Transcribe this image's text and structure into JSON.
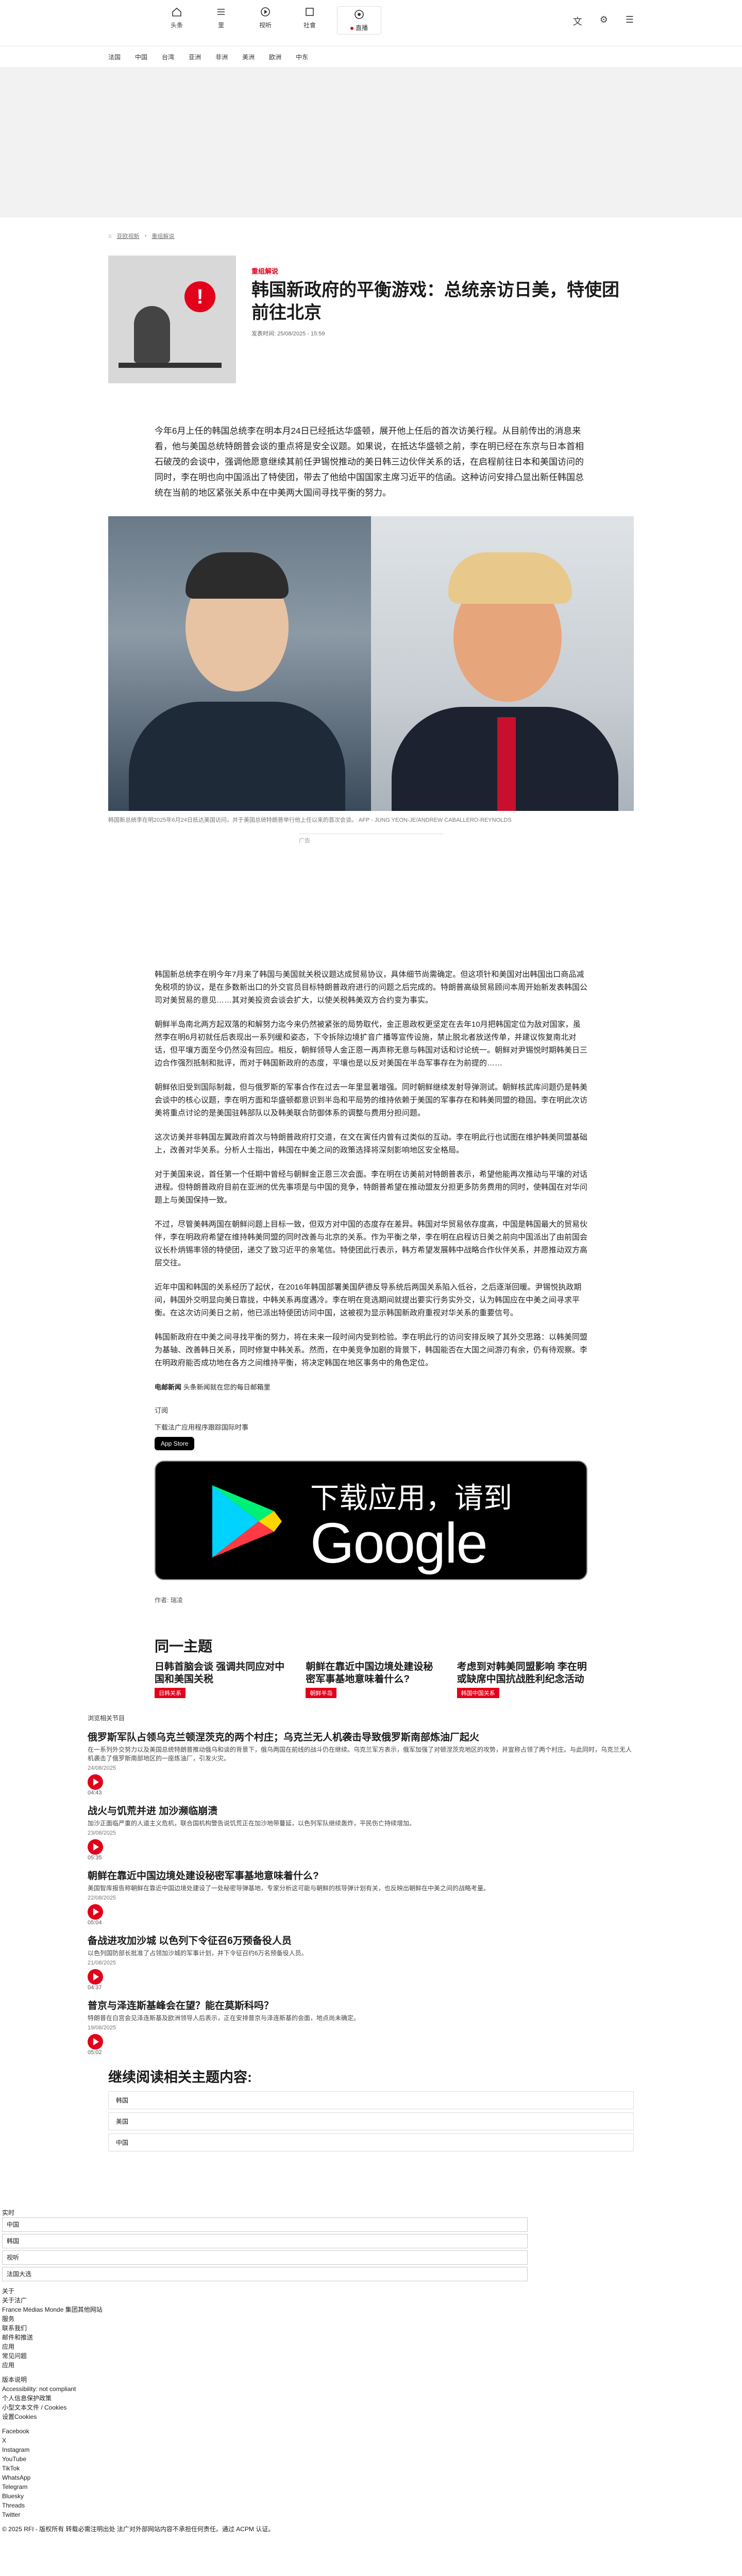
{
  "nav": {
    "items": [
      {
        "label": "头条"
      },
      {
        "label": "里"
      },
      {
        "label": "视听"
      },
      {
        "label": "社會"
      },
      {
        "label": "直播"
      }
    ],
    "live_label": "●跳上 有台"
  },
  "subnav": [
    "法国",
    "中国",
    "台湾",
    "亚洲",
    "非洲",
    "美洲",
    "欧洲",
    "中东"
  ],
  "breadcrumb": [
    "⌂",
    "亚欧视新",
    "重组解说"
  ],
  "article": {
    "kicker": "重组解说",
    "title": "韩国新政府的平衡游戏：总统亲访日美，特使团前往北京",
    "published_label": "发表时间:",
    "published": "25/08/2025 - 15:59",
    "lead": "今年6月上任的韩国总统李在明本月24日已经抵达华盛顿，展开他上任后的首次访美行程。从目前传出的消息来看，他与美国总统特朗普会谈的重点将是安全议题。如果说，在抵达华盛顿之前，李在明已经在东京与日本首相石破茂的会谈中，强调他愿意继续其前任尹锡悦推动的美日韩三边伙伴关系的话，在启程前往日本和美国访问的同时，李在明也向中国派出了特使团，带去了他给中国国家主席习近平的信函。这种访问安排凸显出新任韩国总统在当前的地区紧张关系中在中美两大国间寻找平衡的努力。",
    "photo_caption": "韩国新总统李在明2025年6月24日抵达美国访问，并于美国总统特朗普举行他上任以来的首次会谈。 AFP - JUNG YEON-JE/ANDREW CABALLERO-REYNOLDS",
    "ad_label": "广告",
    "paragraphs": [
      "韩国新总统李在明今年7月来了韩国与美国就关税议题达成贸易协议，具体细节尚需确定。但这项针和美国对出韩国出口商品减免税项的协议，是在多数新出口的外交官员目标特朗普政府进行的问题之后完成的。特朗普高级贸易顾问本周开始新发表韩国公司对美贸易的意见……其对美投资会谈会扩大，以使关税韩美双方合约变为事实。",
      "朝鲜半岛南北两方起双落的和解努力迄今来仍然被紧张的局势取代，金正恩政权更坚定在去年10月把韩国定位为敌对国家，虽然李在明6月初就任后表现出一系列缓和姿态，下令拆除边境扩音广播等宣传设施，禁止脱北者放送传单，并建议恢复南北对话，但平壤方面至今仍然没有回应。相反，朝鲜领导人金正恩一再声称无意与韩国对话和讨论统一。朝鲜对尹锡悦时期韩美日三边合作强烈抵制和批评，而对于韩国新政府的态度，平壤也是以反对美国在半岛军事存在为前提的……",
      "朝鲜依旧受到国际制裁，但与俄罗斯的军事合作在过去一年里显著增强。同时朝鲜继续发射导弹测试。朝鲜核武库问题仍是韩美会谈中的核心议题，李在明方面和华盛顿都意识到半岛和平局势的维持依赖于美国的军事存在和韩美同盟的稳固。李在明此次访美将重点讨论的是美国驻韩部队以及韩美联合防御体系的调整与费用分担问题。",
      "这次访美并非韩国左翼政府首次与特朗普政府打交道，在文在寅任内曾有过类似的互动。李在明此行也试图在维护韩美同盟基础上，改善对华关系。分析人士指出，韩国在中美之间的政策选择将深刻影响地区安全格局。",
      "对于美国来说，首任第一个任期中曾经与朝鲜金正恩三次会面。李在明在访美前对特朗普表示，希望他能再次推动与平壤的对话进程。但特朗普政府目前在亚洲的优先事项是与中国的竞争，特朗普希望在推动盟友分担更多防务费用的同时，使韩国在对华问题上与美国保持一致。",
      "不过，尽管美韩两国在朝鲜问题上目标一致，但双方对中国的态度存在差异。韩国对华贸易依存度高，中国是韩国最大的贸易伙伴，李在明政府希望在维持韩美同盟的同时改善与北京的关系。作为平衡之举，李在明在启程访日美之前向中国派出了由前国会议长朴炳锡率领的特使团，递交了致习近平的亲笔信。特使团此行表示，韩方希望发展韩中战略合作伙伴关系，并愿推动双方高层交往。",
      "近年中国和韩国的关系经历了起伏，在2016年韩国部署美国萨德反导系统后两国关系陷入低谷，之后逐渐回暖。尹锡悦执政期间，韩国外交明显向美日靠拢，中韩关系再度遇冷。李在明在竞选期间就提出要实行务实外交，认为韩国应在中美之间寻求平衡。在这次访问美日之前，他已派出特使团访问中国，这被视为显示韩国新政府重视对华关系的重要信号。",
      "韩国新政府在中美之间寻找平衡的努力，将在未来一段时间内受到检验。李在明此行的访问安排反映了其外交思路：以韩美同盟为基轴、改善韩日关系，同时修复中韩关系。然而，在中美竞争加剧的背景下，韩国能否在大国之间游刃有余，仍有待观察。李在明政府能否成功地在各方之间维持平衡，将决定韩国在地区事务中的角色定位。"
    ],
    "credit_brand": "电邮新闻",
    "credit_text": "头条新闻就在您的每日邮箱里",
    "subscribe": "订阅",
    "app_prompt": "下载法广应用程序跟踪国际时事",
    "app_store": "App Store",
    "gplay_line1": "下载应用，请到",
    "gplay_line2": "Google Play",
    "author_label": "作者:",
    "author": "瑞凌"
  },
  "related": {
    "heading": "同一主题",
    "items": [
      {
        "title": "日韩首脑会谈 强调共同应对中国和美国关税",
        "tag": "日韩关系"
      },
      {
        "title": "朝鲜在靠近中国边境处建设秘密军事基地意味着什么?",
        "tag": "朝鲜半岛"
      },
      {
        "title": "考虑到对韩美同盟影响 李在明或缺席中国抗战胜利纪念活动",
        "tag": "韩国中国关系"
      }
    ]
  },
  "podcast": {
    "label": "浏览相关节目",
    "items": [
      {
        "title": "俄罗斯军队占领乌克兰顿涅茨克的两个村庄；乌克兰无人机袭击导致俄罗斯南部炼油厂起火",
        "summary": "在一系列外交努力以及美国总统特朗普推动俄乌和谈的背景下，俄乌两国在前线的战斗仍在继续。乌克兰军方表示，俄军加强了对顿涅茨克地区的攻势，并宣称占领了两个村庄。与此同时，乌克兰无人机袭击了俄罗斯南部地区的一座炼油厂，引发火灾。",
        "date": "24/08/2025",
        "duration": "04:43"
      },
      {
        "title": "战火与饥荒并进 加沙濒临崩溃",
        "summary": "加沙正面临严重的人道主义危机，联合国机构警告说饥荒正在加沙地带蔓延，以色列军队继续轰炸，平民伤亡持续增加。",
        "date": "23/08/2025",
        "duration": "05:35"
      },
      {
        "title": "朝鲜在靠近中国边境处建设秘密军事基地意味着什么?",
        "summary": "美国智库报告称朝鲜在靠近中国边境处建设了一处秘密导弹基地，专家分析这可能与朝鲜的核导弹计划有关，也反映出朝鲜在中美之间的战略考量。",
        "date": "22/08/2025",
        "duration": "05:04"
      },
      {
        "title": "备战进攻加沙城 以色列下令征召6万预备役人员",
        "summary": "以色列国防部长批准了占领加沙城的军事计划，并下令征召约6万名预备役人员。",
        "date": "21/08/2025",
        "duration": "04:37"
      },
      {
        "title": "普京与泽连斯基峰会在望？能在莫斯科吗？",
        "summary": "特朗普在白宫会见泽连斯基及欧洲领导人后表示，正在安排普京与泽连斯基的会面，地点尚未确定。",
        "date": "19/08/2025",
        "duration": "05:02"
      }
    ]
  },
  "more_read": {
    "heading": "继续阅读相关主题内容:",
    "items": [
      "韩国",
      "美国",
      "中国"
    ]
  },
  "footer": {
    "section_label": "实时",
    "list_items": [
      "中国",
      "韩国",
      "视听",
      "法国大选"
    ],
    "blocks": [
      "关于",
      "关于法广",
      "France Médias Monde 集团其他网站",
      "服务",
      "联系我们",
      "邮件和推送",
      "应用",
      "常见问题",
      "应用"
    ],
    "legal": [
      "版本说明",
      "Accessibility: not compliant",
      "个人信息保护政策",
      "小型文本文件 / Cookies",
      "设置Cookies"
    ],
    "social": [
      "Facebook",
      "X",
      "Instagram",
      "YouTube",
      "TikTok",
      "WhatsApp",
      "Telegram",
      "Bluesky",
      "Threads",
      "Twitter"
    ],
    "copyright": "© 2025 RFI - 版权所有 转载必需注明出处 法广对外部网站内容不承担任何责任。通过 ACPM 认证。"
  }
}
